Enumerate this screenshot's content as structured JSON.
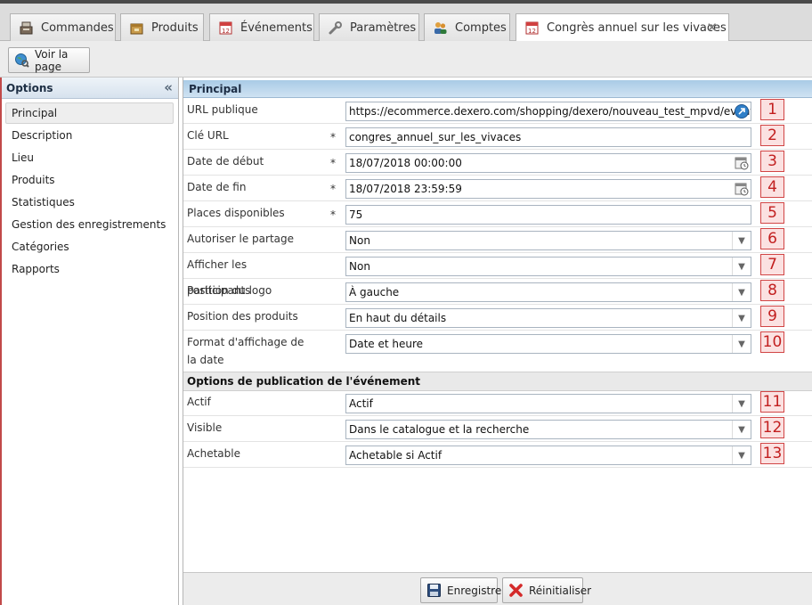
{
  "tabs": [
    {
      "label": "Commandes",
      "icon": "register-icon"
    },
    {
      "label": "Produits",
      "icon": "box-icon"
    },
    {
      "label": "Événements",
      "icon": "calendar-icon"
    },
    {
      "label": "Paramètres",
      "icon": "wrench-icon"
    },
    {
      "label": "Comptes",
      "icon": "users-icon"
    },
    {
      "label": "Congrès annuel sur les vivaces",
      "icon": "calendar-icon",
      "active": true
    }
  ],
  "toolbar": {
    "view_page_label": "Voir la page"
  },
  "sidebar": {
    "title": "Options",
    "items": [
      "Principal",
      "Description",
      "Lieu",
      "Produits",
      "Statistiques",
      "Gestion des enregistrements",
      "Catégories",
      "Rapports"
    ]
  },
  "principal": {
    "title": "Principal",
    "fields": [
      {
        "label": "URL publique",
        "value": "https://ecommerce.dexero.com/shopping/dexero/nouveau_test_mpvd/event",
        "num": "1"
      },
      {
        "label": "Clé URL",
        "required": "*",
        "value": "congres_annuel_sur_les_vivaces",
        "num": "2"
      },
      {
        "label": "Date de début",
        "required": "*",
        "value": "18/07/2018 00:00:00",
        "num": "3"
      },
      {
        "label": "Date de fin",
        "required": "*",
        "value": "18/07/2018 23:59:59",
        "num": "4"
      },
      {
        "label": "Places disponibles",
        "required": "*",
        "value": "75",
        "num": "5"
      },
      {
        "label": "Autoriser le partage",
        "value": "Non",
        "num": "6"
      },
      {
        "label": "Afficher les participants",
        "value": "Non",
        "num": "7"
      },
      {
        "label": "Position du logo",
        "value": "À gauche",
        "num": "8"
      },
      {
        "label": "Position des produits",
        "value": "En haut du détails",
        "num": "9"
      },
      {
        "label": "Format d'affichage de la date",
        "value": "Date et heure",
        "num": "10"
      }
    ]
  },
  "publication": {
    "title": "Options de publication de l'événement",
    "fields": [
      {
        "label": "Actif",
        "value": "Actif",
        "num": "11"
      },
      {
        "label": "Visible",
        "value": "Dans le catalogue et la recherche",
        "num": "12"
      },
      {
        "label": "Achetable",
        "value": "Achetable si Actif",
        "num": "13"
      }
    ]
  },
  "footer": {
    "save_label": "Enregistrer",
    "reset_label": "Réinitialiser"
  },
  "colors": {
    "section_header": "#bcd8ee",
    "number_box_border": "#d14545",
    "number_box_bg": "#fbe1e1"
  }
}
